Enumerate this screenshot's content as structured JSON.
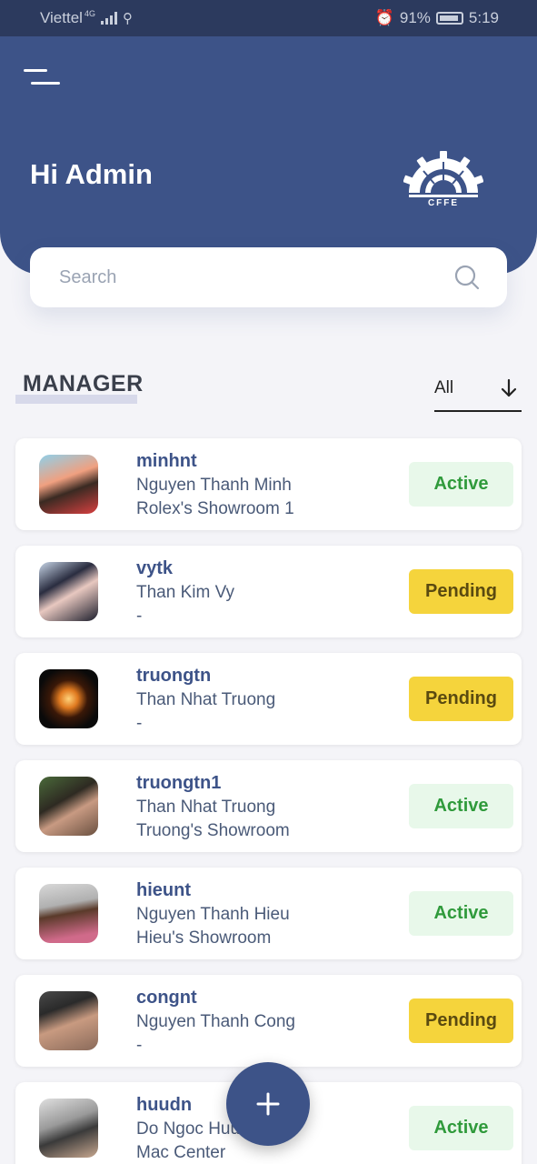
{
  "status_bar": {
    "carrier": "Viettel",
    "network": "4G",
    "battery": "91%",
    "time": "5:19"
  },
  "header": {
    "greeting": "Hi Admin",
    "logo_text": "CFFE"
  },
  "search": {
    "placeholder": "Search"
  },
  "section": {
    "title": "MANAGER",
    "filter_value": "All"
  },
  "managers": [
    {
      "username": "minhnt",
      "full_name": "Nguyen Thanh Minh",
      "showroom": "Rolex's Showroom 1",
      "status": "Active"
    },
    {
      "username": "vytk",
      "full_name": "Than Kim Vy",
      "showroom": "-",
      "status": "Pending"
    },
    {
      "username": "truongtn",
      "full_name": "Than Nhat Truong",
      "showroom": "-",
      "status": "Pending"
    },
    {
      "username": "truongtn1",
      "full_name": "Than Nhat Truong",
      "showroom": "Truong's Showroom",
      "status": "Active"
    },
    {
      "username": "hieunt",
      "full_name": "Nguyen Thanh Hieu",
      "showroom": "Hieu's Showroom",
      "status": "Active"
    },
    {
      "username": "congnt",
      "full_name": "Nguyen Thanh Cong",
      "showroom": "-",
      "status": "Pending"
    },
    {
      "username": "huudn",
      "full_name": "Do Ngoc Huu",
      "showroom": "Mac Center",
      "status": "Active"
    }
  ],
  "colors": {
    "primary": "#3d5388",
    "active_bg": "#e8f8ea",
    "active_text": "#2f9a3b",
    "pending_bg": "#f5d43c"
  },
  "icons": {
    "menu": "menu-icon",
    "search": "search-icon",
    "filter": "arrow-down-icon",
    "add": "plus-icon"
  }
}
